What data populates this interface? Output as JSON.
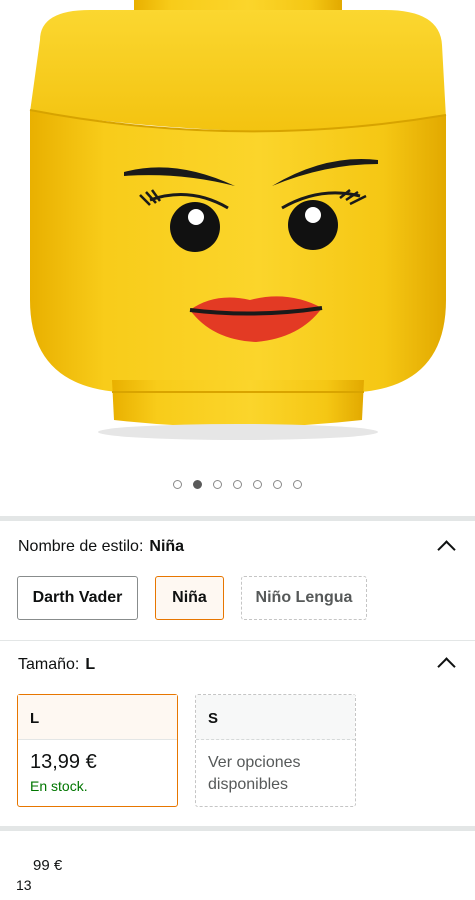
{
  "carousel": {
    "total": 7,
    "active_index": 1
  },
  "style_section": {
    "label": "Nombre de estilo:",
    "value": "Niña",
    "options": [
      {
        "label": "Darth Vader",
        "state": "available"
      },
      {
        "label": "Niña",
        "state": "selected"
      },
      {
        "label": "Niño Lengua",
        "state": "unavailable"
      }
    ]
  },
  "size_section": {
    "label": "Tamaño:",
    "value": "L",
    "options": [
      {
        "label": "L",
        "price": "13,99 €",
        "stock": "En stock.",
        "state": "selected"
      },
      {
        "label": "S",
        "note": "Ver opciones disponibles",
        "state": "unavailable"
      }
    ]
  },
  "price": {
    "fraction": "99 €",
    "whole": "13"
  },
  "colors": {
    "accent_border": "#e77600",
    "in_stock": "#007600",
    "head_yellow": "#f7cc1b",
    "lips": "#e33a24"
  }
}
